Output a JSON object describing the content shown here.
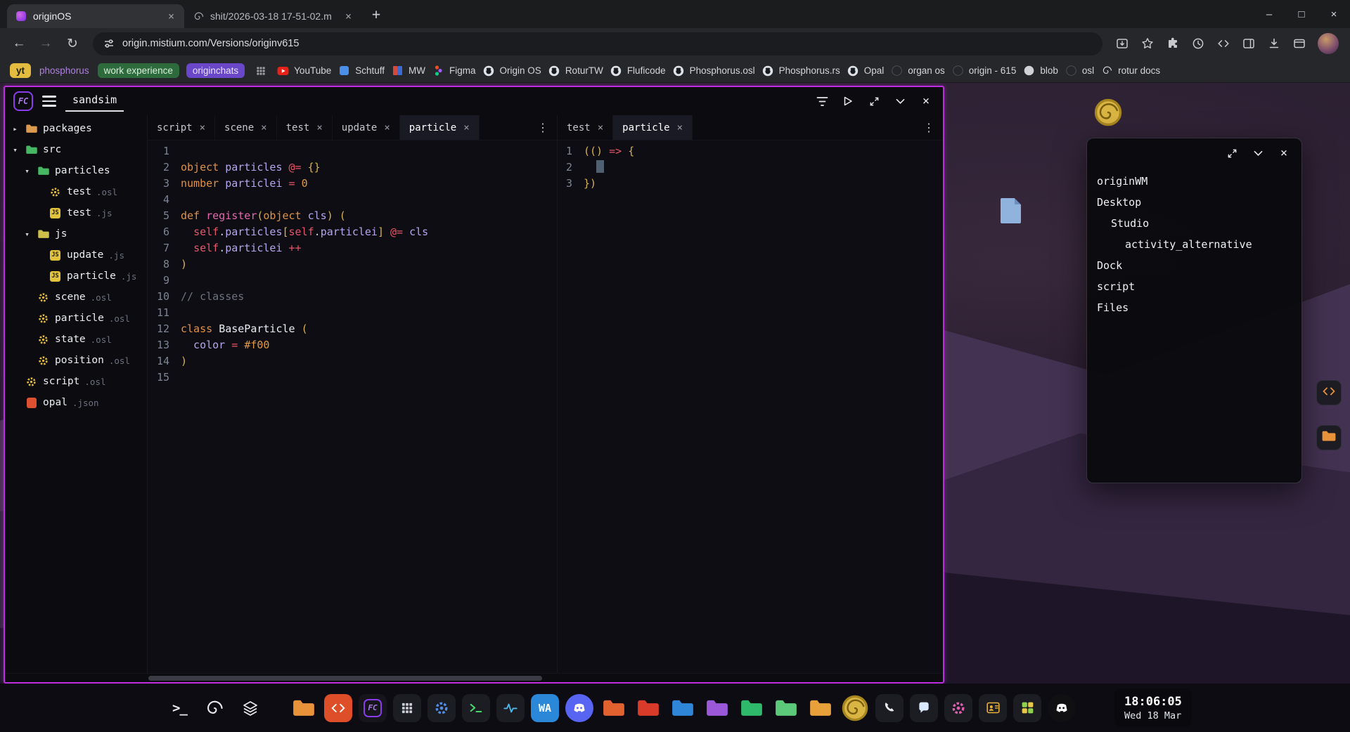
{
  "colors": {
    "accent": "#bd2ee0",
    "kw": "#e09245",
    "ident": "#b6a6ee",
    "op": "#e8566a",
    "paren": "#d8b24e",
    "fn": "#e667b0",
    "num": "#e09a45",
    "comment": "#6e737e",
    "cls": "#e9edf4",
    "txt": "#cfd2dc",
    "cursor": "#516070"
  },
  "icons": {
    "close": "×",
    "minimize": "–",
    "maximize": "□",
    "new_tab": "+",
    "back": "←",
    "forward": "→",
    "reload": "↻",
    "kebab": "⋮",
    "chevron_collapsed": "▸",
    "chevron_expanded": "▾",
    "terminal_prompt": ">_",
    "js_badge": "JS"
  },
  "browser": {
    "tabs": [
      {
        "title": "originOS",
        "active": true,
        "favicon": "origin"
      },
      {
        "title": "shit/2026-03-18 17-51-02.m",
        "active": false,
        "favicon": "spiral"
      }
    ],
    "url": "origin.mistium.com/Versions/originv615"
  },
  "bookmarks": {
    "pinned": [
      {
        "label": "yt",
        "kind": "tag-yellow"
      },
      {
        "label": "phosphorus",
        "kind": "text-purple"
      },
      {
        "label": "work experience",
        "kind": "tag-green"
      },
      {
        "label": "originchats",
        "kind": "tag-purple"
      }
    ],
    "items": [
      {
        "label": "YouTube",
        "icon": "youtube"
      },
      {
        "label": "Schtuff",
        "icon": "blue-square"
      },
      {
        "label": "MW",
        "icon": "mw"
      },
      {
        "label": "Figma",
        "icon": "figma"
      },
      {
        "label": "Origin OS",
        "icon": "github"
      },
      {
        "label": "RoturTW",
        "icon": "github"
      },
      {
        "label": "Fluficode",
        "icon": "github"
      },
      {
        "label": "Phosphorus.osl",
        "icon": "github"
      },
      {
        "label": "Phosphorus.rs",
        "icon": "github"
      },
      {
        "label": "Opal",
        "icon": "github"
      },
      {
        "label": "organ os",
        "icon": "dark"
      },
      {
        "label": "origin - 615",
        "icon": "dark"
      },
      {
        "label": "blob",
        "icon": "light"
      },
      {
        "label": "osl",
        "icon": "dark"
      },
      {
        "label": "rotur docs",
        "icon": "dark-spiral"
      }
    ]
  },
  "app": {
    "workspace": "sandsim",
    "logo_text": "FC",
    "tree": [
      {
        "name": "packages",
        "ext": "",
        "kind": "folder",
        "color": "#dc9a4e",
        "depth": 0,
        "state": "collapsed"
      },
      {
        "name": "src",
        "ext": "",
        "kind": "folder",
        "color": "#46b864",
        "depth": 0,
        "state": "expanded"
      },
      {
        "name": "particles",
        "ext": "",
        "kind": "folder",
        "color": "#46b864",
        "depth": 1,
        "state": "expanded"
      },
      {
        "name": "test",
        "ext": ".osl",
        "kind": "osl",
        "depth": 2
      },
      {
        "name": "test",
        "ext": ".js",
        "kind": "js",
        "depth": 2
      },
      {
        "name": "js",
        "ext": "",
        "kind": "folder",
        "color": "#cdbf4a",
        "depth": 1,
        "state": "expanded"
      },
      {
        "name": "update",
        "ext": ".js",
        "kind": "js",
        "depth": 2
      },
      {
        "name": "particle",
        "ext": ".js",
        "kind": "js",
        "depth": 2
      },
      {
        "name": "scene",
        "ext": ".osl",
        "kind": "osl",
        "depth": 1
      },
      {
        "name": "particle",
        "ext": ".osl",
        "kind": "osl",
        "depth": 1
      },
      {
        "name": "state",
        "ext": ".osl",
        "kind": "osl",
        "depth": 1
      },
      {
        "name": "position",
        "ext": ".osl",
        "kind": "osl",
        "depth": 1
      },
      {
        "name": "script",
        "ext": ".osl",
        "kind": "osl",
        "depth": 0
      },
      {
        "name": "opal",
        "ext": ".json",
        "kind": "json",
        "depth": 0
      }
    ],
    "left_editor": {
      "tabs": [
        {
          "label": "script"
        },
        {
          "label": "scene"
        },
        {
          "label": "test"
        },
        {
          "label": "update"
        },
        {
          "label": "particle",
          "active": true
        }
      ],
      "lines": [
        [],
        [
          {
            "t": "object ",
            "c": "kw"
          },
          {
            "t": "particles ",
            "c": "ident"
          },
          {
            "t": "@= ",
            "c": "op"
          },
          {
            "t": "{}",
            "c": "paren"
          }
        ],
        [
          {
            "t": "number ",
            "c": "kw"
          },
          {
            "t": "particlei ",
            "c": "ident"
          },
          {
            "t": "= ",
            "c": "op"
          },
          {
            "t": "0",
            "c": "num"
          }
        ],
        [],
        [
          {
            "t": "def ",
            "c": "kw"
          },
          {
            "t": "register",
            "c": "fn"
          },
          {
            "t": "(",
            "c": "paren"
          },
          {
            "t": "object ",
            "c": "kw"
          },
          {
            "t": "cls",
            "c": "ident"
          },
          {
            "t": ") (",
            "c": "paren"
          }
        ],
        [
          {
            "t": "  ",
            "c": "txt"
          },
          {
            "t": "self",
            "c": "op"
          },
          {
            "t": ".",
            "c": "txt"
          },
          {
            "t": "particles",
            "c": "ident"
          },
          {
            "t": "[",
            "c": "paren"
          },
          {
            "t": "self",
            "c": "op"
          },
          {
            "t": ".",
            "c": "txt"
          },
          {
            "t": "particlei",
            "c": "ident"
          },
          {
            "t": "] ",
            "c": "paren"
          },
          {
            "t": "@= ",
            "c": "op"
          },
          {
            "t": "cls",
            "c": "ident"
          }
        ],
        [
          {
            "t": "  ",
            "c": "txt"
          },
          {
            "t": "self",
            "c": "op"
          },
          {
            "t": ".",
            "c": "txt"
          },
          {
            "t": "particlei ",
            "c": "ident"
          },
          {
            "t": "++",
            "c": "op"
          }
        ],
        [
          {
            "t": ")",
            "c": "paren"
          }
        ],
        [],
        [
          {
            "t": "// classes",
            "c": "comment"
          }
        ],
        [],
        [
          {
            "t": "class ",
            "c": "kw"
          },
          {
            "t": "BaseParticle ",
            "c": "cls"
          },
          {
            "t": "(",
            "c": "paren"
          }
        ],
        [
          {
            "t": "  color ",
            "c": "ident"
          },
          {
            "t": "= ",
            "c": "op"
          },
          {
            "t": "#f00",
            "c": "num"
          }
        ],
        [
          {
            "t": ")",
            "c": "paren"
          }
        ],
        []
      ]
    },
    "right_editor": {
      "tabs": [
        {
          "label": "test"
        },
        {
          "label": "particle",
          "active": true
        }
      ],
      "lines": [
        [
          {
            "t": "(() ",
            "c": "paren"
          },
          {
            "t": "=> ",
            "c": "op"
          },
          {
            "t": "{",
            "c": "paren"
          }
        ],
        [
          {
            "t": "  ",
            "c": "txt"
          },
          {
            "cursor": true
          }
        ],
        [
          {
            "t": "})",
            "c": "paren"
          }
        ]
      ]
    }
  },
  "wm_window": {
    "items": [
      {
        "label": "originWM",
        "depth": 0
      },
      {
        "label": "Desktop",
        "depth": 0
      },
      {
        "label": "Studio",
        "depth": 1
      },
      {
        "label": "activity_alternative",
        "depth": 2
      },
      {
        "label": "Dock",
        "depth": 0
      },
      {
        "label": "script",
        "depth": 0
      },
      {
        "label": "Files",
        "depth": 0
      }
    ]
  },
  "taskbar": {
    "utility": [
      {
        "name": "terminal-icon",
        "kind": "prompt"
      },
      {
        "name": "rotur-spiral-icon",
        "kind": "spiral"
      },
      {
        "name": "layers-icon",
        "kind": "layers"
      }
    ],
    "dock": [
      {
        "name": "files-folder-app",
        "kind": "folder",
        "color": "#e8923a"
      },
      {
        "name": "code-editor-app",
        "kind": "tile-code",
        "bg": "#de4e28"
      },
      {
        "name": "osl-fc-app",
        "kind": "fc"
      },
      {
        "name": "numpad-app",
        "kind": "tile-grid",
        "fg": "#c8ccd4"
      },
      {
        "name": "settings-blue-app",
        "kind": "tile-gear",
        "fg": "#4f8fe8"
      },
      {
        "name": "terminal-app",
        "kind": "tile-term",
        "fg": "#45d96a"
      },
      {
        "name": "activity-app",
        "kind": "tile-pulse",
        "fg": "#4fb7e8"
      },
      {
        "name": "wa-app",
        "kind": "tile-text",
        "bg": "#2b87d8",
        "fg": "#ffffff",
        "glyph": "WA"
      },
      {
        "name": "discord-app",
        "kind": "discord",
        "bg": "#5865f2"
      },
      {
        "name": "folder-export",
        "kind": "folder",
        "color": "#e2622f"
      },
      {
        "name": "folder-red",
        "kind": "folder",
        "color": "#d93b2b"
      },
      {
        "name": "folder-blue",
        "kind": "folder",
        "color": "#2f86d9"
      },
      {
        "name": "folder-purple",
        "kind": "folder",
        "color": "#9b59d9"
      },
      {
        "name": "folder-green",
        "kind": "folder",
        "color": "#2fb96a"
      },
      {
        "name": "folder-green-light",
        "kind": "folder",
        "color": "#5cc97a"
      },
      {
        "name": "folder-amber",
        "kind": "folder",
        "color": "#e8a03a"
      },
      {
        "name": "origin-badge",
        "kind": "badge"
      },
      {
        "name": "phone-app",
        "kind": "tile-phone",
        "fg": "#e8e8f0"
      },
      {
        "name": "chat-app",
        "kind": "tile-bubble",
        "fg": "#d8e8ff"
      },
      {
        "name": "settings-pink-app",
        "kind": "tile-gear",
        "fg": "#e05fb0"
      },
      {
        "name": "contacts-app",
        "kind": "tile-contact",
        "fg": "#e8b23a"
      },
      {
        "name": "apps-grid-app",
        "kind": "tile-grid4"
      },
      {
        "name": "discord-dark-app",
        "kind": "discord",
        "bg": "#101013"
      }
    ],
    "clock": {
      "time": "18:06:05",
      "date": "Wed 18 Mar"
    }
  }
}
